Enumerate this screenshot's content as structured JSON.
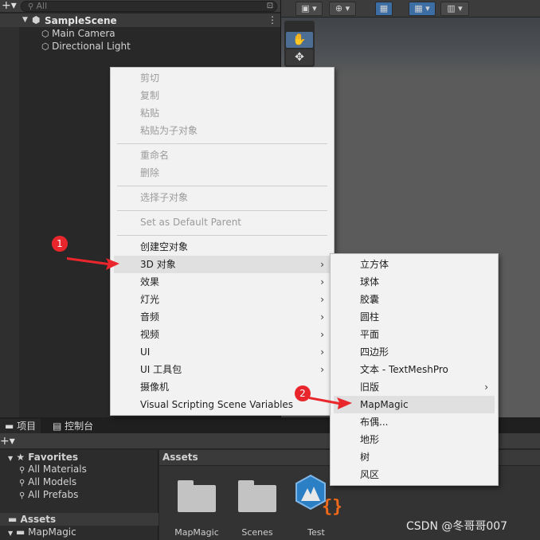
{
  "hierarchy": {
    "add_label": "+▾",
    "search_placeholder": "All",
    "scene_name": "SampleScene",
    "items": [
      "Main Camera",
      "Directional Light"
    ]
  },
  "scene_view": {
    "toolbar": [
      "▣ ▾",
      "⊕ ▾",
      "▦",
      "▦ ▾",
      "▥ ▾"
    ],
    "tools": [
      "✋",
      "✥"
    ]
  },
  "context_menu": {
    "group1": [
      "剪切",
      "复制",
      "粘贴",
      "粘贴为子对象"
    ],
    "group2": [
      "重命名",
      "删除"
    ],
    "group3": [
      "选择子对象"
    ],
    "group4": [
      "Set as Default Parent"
    ],
    "group5": [
      {
        "label": "创建空对象"
      },
      {
        "label": "3D 对象",
        "arrow": "›"
      },
      {
        "label": "效果",
        "arrow": "›"
      },
      {
        "label": "灯光",
        "arrow": "›"
      },
      {
        "label": "音频",
        "arrow": "›"
      },
      {
        "label": "视频",
        "arrow": "›"
      },
      {
        "label": "UI",
        "arrow": "›"
      },
      {
        "label": "UI 工具包",
        "arrow": "›"
      },
      {
        "label": "摄像机"
      },
      {
        "label": "Visual Scripting Scene Variables"
      }
    ]
  },
  "submenu": {
    "items": [
      {
        "label": "立方体"
      },
      {
        "label": "球体"
      },
      {
        "label": "胶囊"
      },
      {
        "label": "圆柱"
      },
      {
        "label": "平面"
      },
      {
        "label": "四边形"
      },
      {
        "label": "文本 - TextMeshPro"
      },
      {
        "label": "旧版",
        "arrow": "›"
      },
      {
        "label": "MapMagic"
      },
      {
        "label": "布偶..."
      },
      {
        "label": "地形"
      },
      {
        "label": "树"
      },
      {
        "label": "风区"
      }
    ]
  },
  "bottom": {
    "tab_project": "项目",
    "tab_console": "控制台",
    "add_label": "+▾",
    "favorites_title": "Favorites",
    "favorites": [
      "All Materials",
      "All Models",
      "All Prefabs"
    ],
    "assets_title": "Assets",
    "assets_child": "MapMagic",
    "assets_header": "Assets",
    "asset_items": [
      "MapMagic",
      "Scenes",
      "Test"
    ]
  },
  "annotations": {
    "badge1": "1",
    "badge2": "2",
    "watermark": "CSDN @冬哥哥007"
  },
  "colors": {
    "badge_red": "#e8262b",
    "menu_bg": "#f2f2f2",
    "highlight": "#e0e0e0"
  }
}
